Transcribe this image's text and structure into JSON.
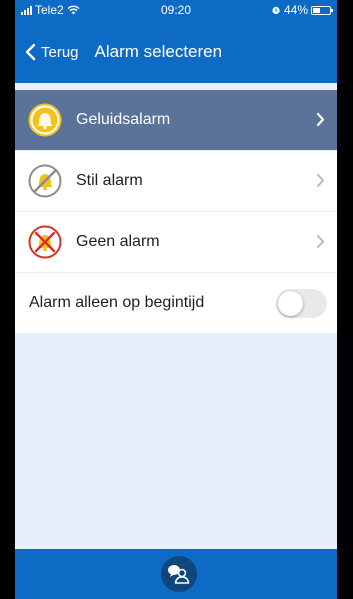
{
  "status": {
    "carrier": "Tele2",
    "time": "09:20",
    "battery": "44%",
    "battery_level": 0.44
  },
  "nav": {
    "back_label": "Terug",
    "title": "Alarm selecteren"
  },
  "options": [
    {
      "label": "Geluidsalarm",
      "icon": "bell-sound-icon",
      "selected": true
    },
    {
      "label": "Stil alarm",
      "icon": "bell-silent-icon",
      "selected": false
    },
    {
      "label": "Geen alarm",
      "icon": "bell-none-icon",
      "selected": false
    }
  ],
  "toggle": {
    "label": "Alarm alleen op begintijd",
    "on": false
  },
  "footer": {
    "button_icon": "contact-icon"
  },
  "colors": {
    "brand_blue": "#0d6bc6",
    "selected_row": "#5b7299",
    "background": "#e5f0fb",
    "bell_yellow": "#f3c21a",
    "cross_red": "#d9302a"
  }
}
